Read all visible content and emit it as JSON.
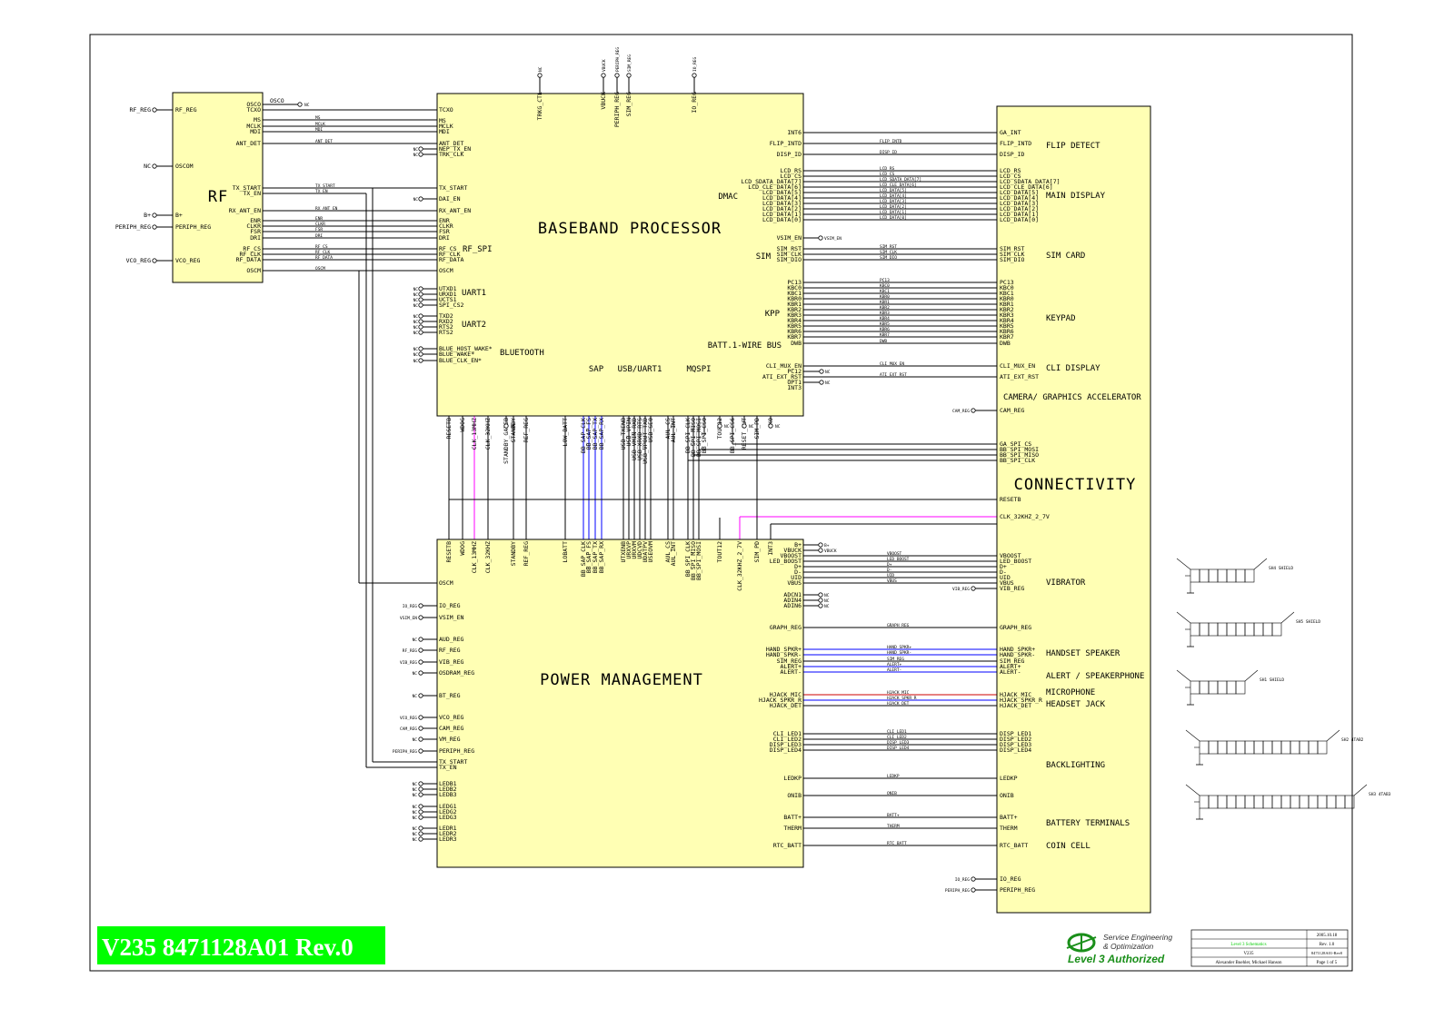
{
  "banner": "V235 8471128A01 Rev.0",
  "nc": "NC",
  "colors": {
    "block_fill": "#ffffb4",
    "banner_green": "#00ff00",
    "bus_blue": "#0000ff",
    "clock_pink": "#ff00ff",
    "mic_red": "#cc0000"
  },
  "rf": {
    "title": "RF",
    "osco_net": "OSCO",
    "left_pins": [
      "RF_REG",
      "OSCOM",
      "B+",
      "PERIPH_REG",
      "VCO_REG"
    ],
    "left_ext": [
      "RF_REG",
      "NC",
      "B+",
      "PERIPH_REG",
      "VCO_REG"
    ],
    "right_pins": [
      "OSCO",
      "TCXO",
      "MS",
      "MCLK",
      "MDI",
      "ANT_DET",
      "TX_START",
      "TX_EN",
      "RX_ANT_EN",
      "ENR",
      "CLKR",
      "FSR",
      "DRI",
      "RF_CS",
      "RF_CLK",
      "RF_DATA",
      "OSCM"
    ]
  },
  "baseband": {
    "title": "BASEBAND PROCESSOR",
    "sections": [
      "DMAC",
      "RF_SPI",
      "UART1",
      "UART2",
      "BLUETOOTH",
      "SIM",
      "KPP",
      "BATT.1-WIRE BUS",
      "SAP",
      "USB/UART1",
      "MQSPI"
    ],
    "left_pins": [
      "TCXO",
      "MS",
      "MCLK",
      "MDI",
      "ANT_DET",
      "NEP_TX_EN",
      "TRK_CLK",
      "TX_START",
      "DAI_EN",
      "RX_ANT_EN",
      "ENR",
      "CLKR",
      "FSR",
      "DRI",
      "RF_CS",
      "RF_CLK",
      "RF_DATA",
      "OSCM",
      "UTXD1",
      "URXD1",
      "UCTS1",
      "SPI_CS2",
      "TXD2",
      "RXD2",
      "RTS2",
      "RTS2",
      "BLUE_HOST_WAKE*",
      "BLUE_WAKE*",
      "BLUE_CLK_EN*"
    ],
    "right_pins": [
      "INT6",
      "FLIP_INTD",
      "DISP_ID",
      "LCD_RS",
      "LCD_CS",
      "LCD_SDATA_DATA[7]",
      "LCD_CLE_DATA[6]",
      "LCD_DATA[5]",
      "LCD_DATA[4]",
      "LCD_DATA[3]",
      "LCD_DATA[2]",
      "LCD_DATA[1]",
      "LCD_DATA[0]",
      "VSIM_EN",
      "SIM_RST",
      "SIM_CLK",
      "SIM_DIO",
      "PC13",
      "KBC0",
      "KBC1",
      "KBR0",
      "KBR1",
      "KBR2",
      "KBR3",
      "KBR4",
      "KBR5",
      "KBR6",
      "KBR7",
      "DWB",
      "CLI_MUX_EN",
      "PC12",
      "ATI_EXT_RST",
      "OPT1",
      "INT3"
    ],
    "top_pins": [
      "TRKG_CTL",
      "VBUCK",
      "PERIPH_REG",
      "SIM_REG",
      "IO_REG"
    ],
    "top_ext": [
      "NC",
      "VBUCK",
      "PERIPH_REG",
      "SIM_REG",
      "IO_REG"
    ],
    "bottom_pins": [
      "RESETB",
      "WDOG",
      "CLK_13MHZ",
      "CLK_32KHZ",
      "STANDBY_GATEB",
      "STANDBY",
      "REF_REG",
      "LOW_BATT",
      "BB_SAP_CLK",
      "BB_SAP_FS",
      "BB_SAP_TX",
      "BB_SAP_RX",
      "USB_TXENB",
      "USB_VPIN",
      "USB_VMIN_RXD",
      "USB_XRXD_RTS",
      "USB_VPOUT_TXD",
      "USB_SE0",
      "AUL_CS",
      "AUL_INT",
      "BB_SPI_CLK",
      "BB_SPI_MISO",
      "BB_SPI_MOSI",
      "BB_SPI_CS0",
      "TOUT12",
      "BB_SPI_CS6",
      "RESET_OUT",
      "SIM_PD",
      "CKO"
    ]
  },
  "power": {
    "title": "POWER MANAGEMENT",
    "top_pins": [
      "RESETB",
      "WDOG",
      "CLK_13MHZ",
      "CLK_32KHZ",
      "STANDBY",
      "REF_REG",
      "LOBATT",
      "BB_SAP_CLK",
      "BB_SAP_FS",
      "BB_SAP_TX",
      "BB_SAP_RX",
      "UTXENB",
      "URXVP",
      "URXVM",
      "UDCVD",
      "UDATPV",
      "USEOVM",
      "AUL_CS",
      "AUL_INT",
      "BB_SPI_CLK",
      "BB_SPI_MISO",
      "BB_SPI_MOSI",
      "TOUT12",
      "CLK_32KHZ_2_7V",
      "SIM_PD",
      "INT3"
    ],
    "left_pins": [
      "OSCM",
      "IO_REG",
      "VSIM_EN",
      "AUD_REG",
      "RF_REG",
      "VIB_REG",
      "OSDRAM_REG",
      "BT_REG",
      "VCO_REG",
      "CAM_REG",
      "VM_REG",
      "PERIPH_REG",
      "TX_START",
      "TX_EN",
      "LEDB1",
      "LEDB2",
      "LEDB3",
      "LEDG1",
      "LEDG2",
      "LEDG3",
      "LEDR1",
      "LEDR2",
      "LEDR3"
    ],
    "left_ext": [
      "",
      "IO_REG",
      "VSIM_EN",
      "NC",
      "RF_REG",
      "VIB_REG",
      "NC",
      "NC",
      "VCO_REG",
      "CAM_REG",
      "NC",
      "PERIPH_REG",
      "",
      "",
      "NC",
      "NC",
      "NC",
      "NC",
      "NC",
      "NC",
      "NC",
      "NC",
      "NC"
    ],
    "right_pins": [
      "B+",
      "VBUCK",
      "VBOOST",
      "LED_BOOST",
      "D+",
      "D-",
      "UID",
      "VBUS",
      "ADCN1",
      "ADIN4",
      "ADIN6",
      "GRAPH_REG",
      "HAND_SPKR+",
      "HAND_SPKR-",
      "SIM_REG",
      "ALERT+",
      "ALERT-",
      "HJACK_MIC",
      "HJACK_SPKR_R",
      "HJACK_DET",
      "CLI_LED1",
      "CLI_LED2",
      "DISP_LED3",
      "DISP_LED4",
      "LEDKP",
      "ONIB",
      "BATT+",
      "THERM",
      "RTC_BATT"
    ],
    "right_ext": [
      "B+",
      "VBUCK"
    ]
  },
  "connectivity": {
    "title": "CONNECTIVITY",
    "sections": [
      "FLIP DETECT",
      "MAIN DISPLAY",
      "SIM CARD",
      "KEYPAD",
      "CLI DISPLAY",
      "CAMERA/ GRAPHICS ACCELERATOR",
      "VIBRATOR",
      "HANDSET SPEAKER",
      "ALERT / SPEAKERPHONE",
      "MICROPHONE",
      "HEADSET JACK",
      "BACKLIGHTING",
      "BATTERY TERMINALS",
      "COIN CELL"
    ],
    "left_pins": [
      "GA_INT",
      "FLIP_INTD",
      "DISP_ID",
      "LCD_RS",
      "LCD_CS",
      "LCD_SDATA_DATA[7]",
      "LCD_CLE_DATA[6]",
      "LCD_DATA[5]",
      "LCD_DATA[4]",
      "LCD_DATA[3]",
      "LCD_DATA[2]",
      "LCD_DATA[1]",
      "LCD_DATA[0]",
      "SIM_RST",
      "SIM_CLK",
      "SIM_DIO",
      "PC13",
      "KBC0",
      "KBC1",
      "KBR0",
      "KBR1",
      "KBR2",
      "KBR3",
      "KBR4",
      "KBR5",
      "KBR6",
      "KBR7",
      "DWB",
      "CLI_MUX_EN",
      "ATI_EXT_RST",
      "CAM_REG",
      "GA_SPI_CS",
      "BB_SPI_MOSI",
      "BB_SPI_MISO",
      "BB_SPI_CLK",
      "RESETB",
      "CLK_32KHZ_2_7V",
      "VBOOST",
      "LED_BOOST",
      "D+",
      "D-",
      "UID",
      "VBUS",
      "VIB_REG",
      "GRAPH_REG",
      "HAND_SPKR+",
      "HAND_SPKR-",
      "SIM_REG",
      "ALERT+",
      "ALERT-",
      "HJACK_MIC",
      "HJACK_SPKR_R",
      "HJACK_DET",
      "DISP_LED1",
      "DISP_LED2",
      "DISP_LED3",
      "DISP_LED4",
      "LEDKP",
      "ONIB",
      "BATT+",
      "THERM",
      "RTC_BATT",
      "IO_REG",
      "PERIPH_REG"
    ]
  },
  "shields": [
    "SH4 SHIELD",
    "SH5 SHIELD",
    "SH1 SHIELD",
    "SH2 4TAB2",
    "SH3 4TAB3"
  ],
  "logo": {
    "line1": "Service Engineering",
    "line2": "& Optimization",
    "line3": "Level 3 Authorized"
  },
  "title_block": {
    "date": "2005.10.18",
    "doc": "Level 3 Schematics",
    "rev": "Rev. 1.0",
    "model": "V235",
    "part": "8471128A01-Rev0",
    "authors": "Alexander Buehler, Mickael Hanson",
    "page": "Page 1 of 5"
  }
}
